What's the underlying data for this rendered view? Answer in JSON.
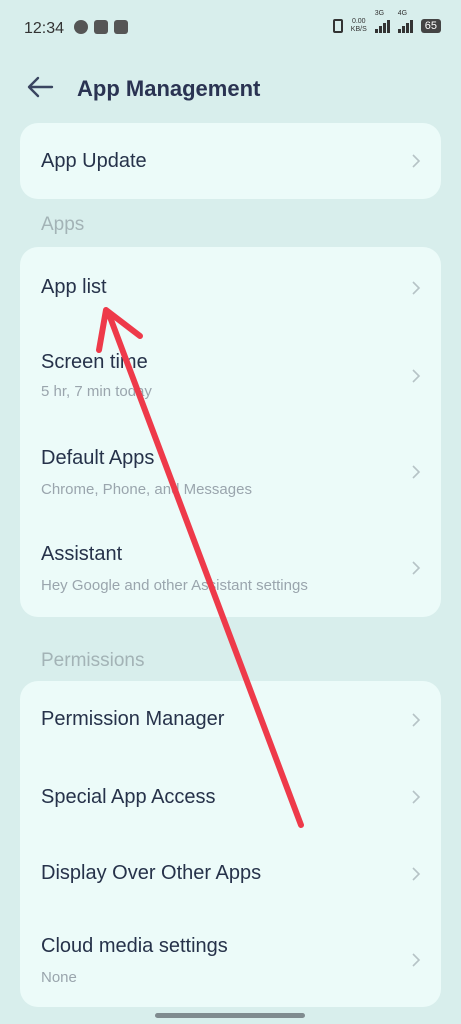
{
  "status_bar": {
    "time": "12:34",
    "net_speed_top": "0.00",
    "net_speed_bottom": "KB/S",
    "signal1": "3G",
    "signal2": "4G",
    "battery": "65"
  },
  "header": {
    "title": "App Management"
  },
  "card1": {
    "items": [
      {
        "title": "App Update"
      }
    ]
  },
  "sections": {
    "apps": "Apps",
    "permissions": "Permissions"
  },
  "apps": {
    "items": [
      {
        "title": "App list"
      },
      {
        "title": "Screen time",
        "subtitle": "5 hr, 7 min today"
      },
      {
        "title": "Default Apps",
        "subtitle": "Chrome, Phone, and Messages"
      },
      {
        "title": "Assistant",
        "subtitle": "Hey Google and other Assistant settings"
      }
    ]
  },
  "permissions": {
    "items": [
      {
        "title": "Permission Manager"
      },
      {
        "title": "Special App Access"
      },
      {
        "title": "Display Over Other Apps"
      },
      {
        "title": "Cloud media settings",
        "subtitle": "None"
      }
    ]
  },
  "colors": {
    "background": "#d8eeec",
    "card": "#ecfbf9",
    "annotation_arrow": "#ee3a4a"
  }
}
